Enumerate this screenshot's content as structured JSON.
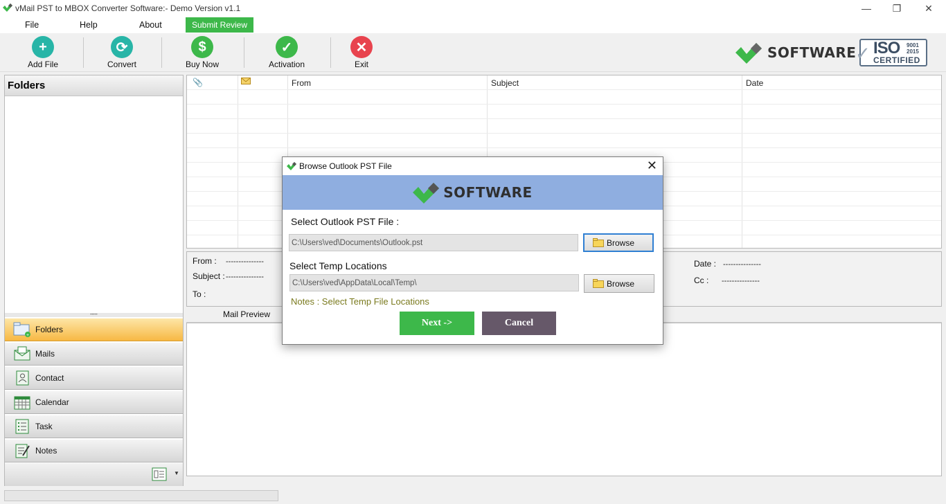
{
  "window": {
    "title": "vMail PST to MBOX Converter Software:- Demo Version v1.1"
  },
  "menu": {
    "file": "File",
    "help": "Help",
    "about": "About",
    "submit_review": "Submit Review"
  },
  "toolbar": {
    "add_file": "Add File",
    "convert": "Convert",
    "buy_now": "Buy Now",
    "activation": "Activation",
    "exit": "Exit"
  },
  "brand": {
    "name": "SOFTWARE",
    "iso_big": "ISO",
    "iso_num1": "9001",
    "iso_num2": "2015",
    "iso_cert": "CERTIFIED"
  },
  "left_panel": {
    "header": "Folders",
    "nav": [
      {
        "label": "Folders",
        "icon": "folder-icon"
      },
      {
        "label": "Mails",
        "icon": "mail-icon"
      },
      {
        "label": "Contact",
        "icon": "contact-icon"
      },
      {
        "label": "Calendar",
        "icon": "calendar-icon"
      },
      {
        "label": "Task",
        "icon": "task-icon"
      },
      {
        "label": "Notes",
        "icon": "notes-icon"
      }
    ]
  },
  "grid": {
    "columns": [
      "",
      "",
      "From",
      "Subject",
      "Date"
    ]
  },
  "preview": {
    "from_label": "From :",
    "subject_label": "Subject :",
    "to_label": "To :",
    "date_label": "Date :",
    "cc_label": "Cc :",
    "from_value": "---------------",
    "subject_value": "---------------",
    "date_value": "---------------",
    "cc_value": "---------------",
    "tab": "Mail Preview"
  },
  "dialog": {
    "title": "Browse Outlook PST File",
    "banner": "SOFTWARE",
    "pst_label": "Select Outlook PST File :",
    "pst_path": "C:\\Users\\ved\\Documents\\Outlook.pst",
    "temp_label": "Select Temp Locations",
    "temp_path": "C:\\Users\\ved\\AppData\\Local\\Temp\\",
    "browse": "Browse",
    "notes": "Notes :  Select Temp File Locations",
    "next": "Next  ->",
    "cancel": "Cancel"
  },
  "colors": {
    "accent_green": "#3db84a",
    "cancel_purple": "#665869",
    "banner_blue": "#8faee0",
    "active_nav": "#f7b844"
  }
}
